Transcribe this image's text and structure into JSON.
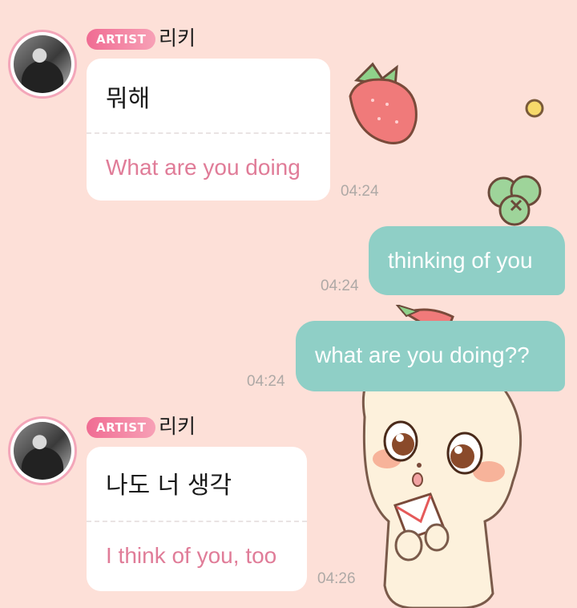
{
  "messages": [
    {
      "sender": "artist",
      "badge": "ARTIST",
      "name": "리키",
      "original": "뭐해",
      "translation": "What are you doing",
      "time": "04:24"
    },
    {
      "sender": "me",
      "text": "thinking of you",
      "time": "04:24"
    },
    {
      "sender": "me",
      "text": "what are you doing??",
      "time": "04:24"
    },
    {
      "sender": "artist",
      "badge": "ARTIST",
      "name": "리키",
      "original": "나도 너 생각",
      "translation": "I think of you, too",
      "time": "04:26"
    }
  ],
  "decorations": [
    "strawberry-sticker",
    "clover-sticker",
    "cat-character-sticker"
  ],
  "colors": {
    "background": "#fde0d8",
    "badge": "#f06c93",
    "translation_text": "#e07c98",
    "my_bubble": "#8fcfc6",
    "timestamp": "#aea9a6"
  }
}
